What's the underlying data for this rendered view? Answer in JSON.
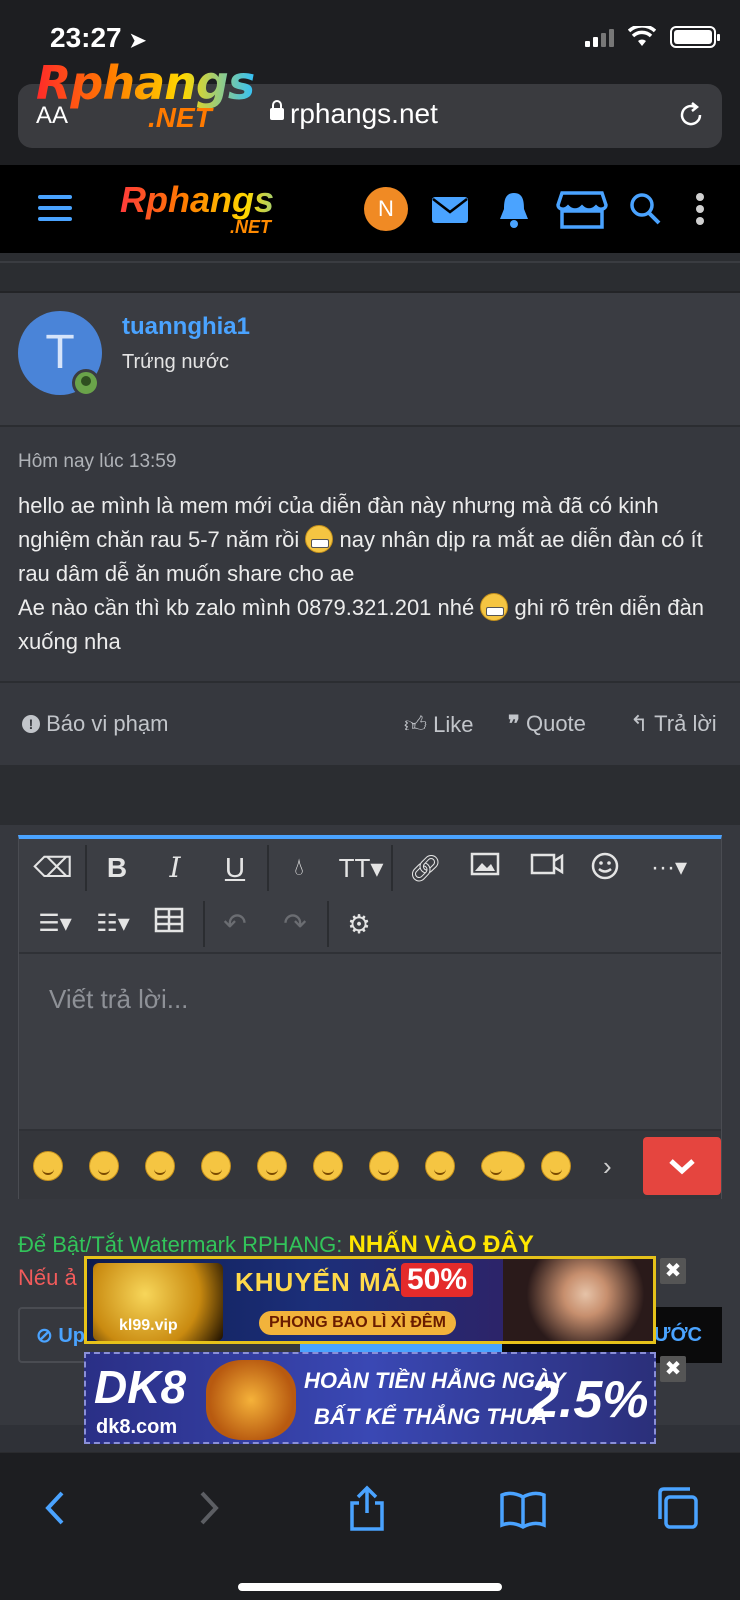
{
  "status": {
    "time": "23:27"
  },
  "browser": {
    "text_size_label": "AA",
    "url": "rphangs.net",
    "logo_top": "Rphangs",
    "logo_bottom": ".NET"
  },
  "site": {
    "logo_top": "Rphangs",
    "logo_bottom": ".NET",
    "user_initial": "N"
  },
  "post": {
    "avatar_letter": "T",
    "username": "tuannghia1",
    "user_title": "Trứng nước",
    "timestamp": "Hôm nay lúc 13:59",
    "body_part1": "hello ae mình là mem mới của diễn đàn này nhưng mà đã có kinh nghiệm chăn rau 5-7 năm rồi ",
    "body_part2": " nay nhân dịp ra mắt ae diễn đàn có ít rau dâm dễ ăn muốn share cho ae",
    "body_part3": "Ae nào cần thì kb zalo mình 0879.321.201 nhé ",
    "body_part4": " ghi rõ trên diễn đàn xuống nha",
    "actions": {
      "report": "Báo vi phạm",
      "like": "Like",
      "quote": "Quote",
      "reply": "Trả lời"
    }
  },
  "editor": {
    "placeholder": "Viết trả lời...",
    "watermark_text": "Để Bật/Tắt Watermark RPHANG:",
    "watermark_link": "NHẤN VÀO ĐÂY",
    "note_prefix": "Nếu ả",
    "upload_label": "Up",
    "preview_label": "ƯỚC"
  },
  "ads": {
    "ad1": {
      "site": "kl99.vip",
      "headline": "KHUYẾN MÃI",
      "percent": "50%",
      "subline": "PHONG BAO LÌ XÌ ĐÊM"
    },
    "ad2": {
      "logo": "DK8",
      "site": "dk8.com",
      "line1": "HOÀN TIỀN HẰNG NGÀY",
      "line2": "BẤT KỂ THẮNG THUA",
      "percent": "2.5%"
    }
  },
  "colors": {
    "accent": "#4aa3ff",
    "submit": "#e5453f",
    "watermark_green": "#32c45a",
    "watermark_yellow": "#ffe600",
    "note_red": "#f25b5b"
  }
}
